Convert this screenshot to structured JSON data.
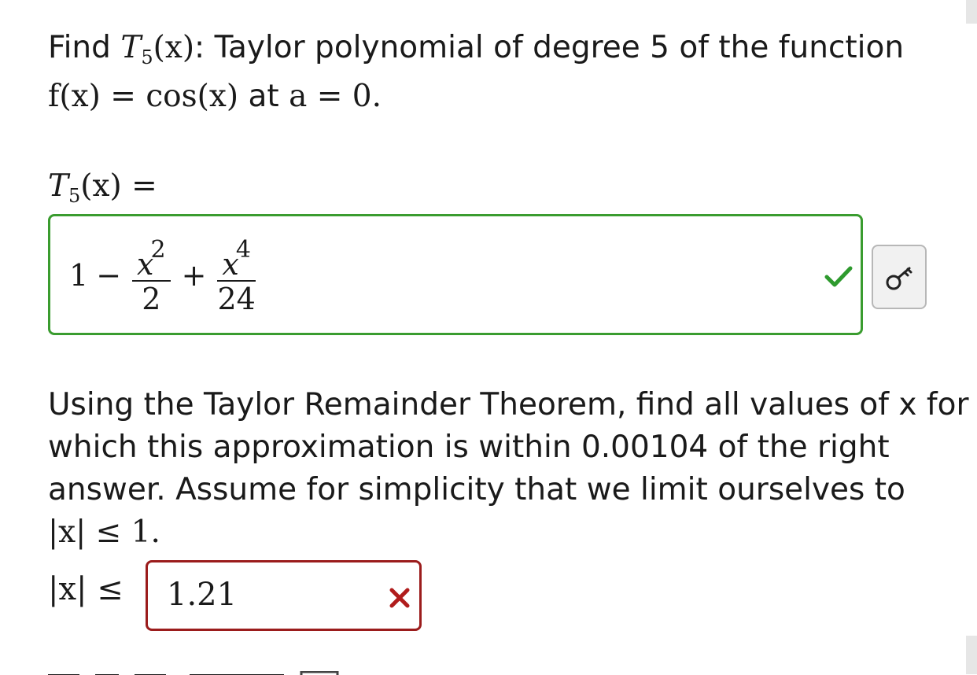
{
  "question1": {
    "line1_prefix": "Find ",
    "line1_T": "T",
    "line1_sub": "5",
    "line1_arg": "(x)",
    "line1_text": ": Taylor polynomial of degree 5 of the function",
    "line2_fx": "f(x) = cos(x)",
    "line2_at": " at ",
    "line2_a": "a = 0."
  },
  "lhs": {
    "T": "T",
    "sub": "5",
    "rest": "(x) ="
  },
  "answer1": {
    "term1": "1",
    "minus": "−",
    "frac1_num": "x",
    "frac1_pow": "2",
    "frac1_den": "2",
    "plus": "+",
    "frac2_num": "x",
    "frac2_pow": "4",
    "frac2_den": "24",
    "status": "correct",
    "status_color": "#2e9a2e"
  },
  "key_button": {
    "icon": "key-icon"
  },
  "question2": {
    "line1": "Using the Taylor Remainder Theorem, find all values of x for",
    "line2": "which this approximation is within 0.00104 of the right",
    "line3": "answer. Assume for simplicity that we limit ourselves to",
    "line4": "|x| ≤ 1."
  },
  "answer2": {
    "label": "|x| ≤",
    "value": "1.21",
    "status": "incorrect",
    "status_color": "#b01c1c"
  }
}
